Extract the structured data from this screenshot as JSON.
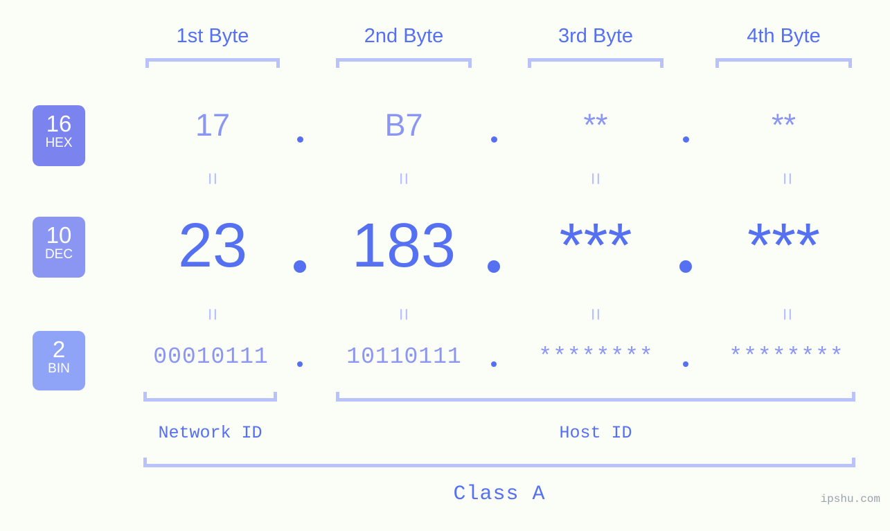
{
  "meta": {
    "background_color": "#fbfdf7",
    "accent_color": "#5570f1",
    "accent_light_color": "#8b96f3",
    "bracket_color": "#b9c2fb",
    "watermark": "ipshu.com"
  },
  "byte_headers": [
    {
      "label": "1st Byte"
    },
    {
      "label": "2nd Byte"
    },
    {
      "label": "3rd Byte"
    },
    {
      "label": "4th Byte"
    }
  ],
  "bases": [
    {
      "number": "16",
      "name": "HEX",
      "color": "#7b84ee"
    },
    {
      "number": "10",
      "name": "DEC",
      "color": "#8b96f3"
    },
    {
      "number": "2",
      "name": "BIN",
      "color": "#8fa3f7"
    }
  ],
  "rows": {
    "hex": {
      "base": "16",
      "label": "HEX",
      "values": [
        "17",
        "B7",
        "**",
        "**"
      ]
    },
    "dec": {
      "base": "10",
      "label": "DEC",
      "values": [
        "23",
        "183",
        "***",
        "***"
      ]
    },
    "bin": {
      "base": "2",
      "label": "BIN",
      "values": [
        "00010111",
        "10110111",
        "********",
        "********"
      ]
    }
  },
  "separators": {
    "dot": ".",
    "equals": "="
  },
  "segments": {
    "network_id": "Network ID",
    "host_id": "Host ID",
    "class": "Class A"
  },
  "chart_data": {
    "type": "table",
    "title": "IP address byte breakdown",
    "columns": [
      "1st Byte",
      "2nd Byte",
      "3rd Byte",
      "4th Byte"
    ],
    "row_labels": [
      "16 HEX",
      "10 DEC",
      "2 BIN"
    ],
    "rows": [
      [
        "17",
        "B7",
        "**",
        "**"
      ],
      [
        "23",
        "183",
        "***",
        "***"
      ],
      [
        "00010111",
        "10110111",
        "********",
        "********"
      ]
    ],
    "annotations": {
      "network_id_span": "1st Byte",
      "host_id_span": "2nd Byte - 4th Byte",
      "class": "Class A"
    }
  }
}
